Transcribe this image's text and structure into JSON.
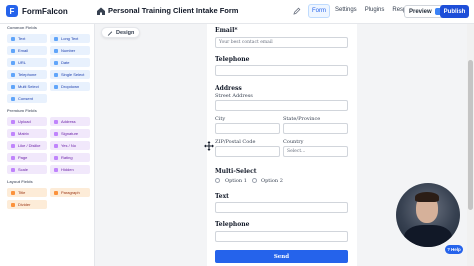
{
  "app": {
    "name": "FormFalcon",
    "logo_letter": "F"
  },
  "header": {
    "form_title": "Personal Training Client Intake Form",
    "tabs": [
      {
        "label": "Form",
        "active": true
      },
      {
        "label": "Settings",
        "active": false
      },
      {
        "label": "Plugins",
        "active": false
      },
      {
        "label": "Responses",
        "active": false
      }
    ],
    "preview_label": "Preview",
    "publish_label": "Publish"
  },
  "sidebar": {
    "common_title": "Common Fields",
    "common": [
      "Text",
      "Long Text",
      "Email",
      "Number",
      "URL",
      "Date",
      "Telephone",
      "Single Select",
      "Multi Select",
      "Dropdown",
      "Consent"
    ],
    "premium_title": "Premium Fields",
    "premium": [
      "Upload",
      "Address",
      "Matrix",
      "Signature",
      "Like / Dislike",
      "Yes / No",
      "Page",
      "Rating",
      "Scale",
      "Hidden"
    ],
    "layout_title": "Layout Fields",
    "layout": [
      "Title",
      "Paragraph",
      "Divider"
    ]
  },
  "canvas": {
    "design_label": "Design",
    "form": {
      "email_label": "Email*",
      "email_placeholder": "Your best contact email",
      "telephone_label": "Telephone",
      "address_label": "Address",
      "street_label": "Street Address",
      "city_label": "City",
      "state_label": "State/Province",
      "zip_label": "ZIP/Postal Code",
      "country_label": "Country",
      "country_placeholder": "Select...",
      "multiselect_label": "Multi-Select",
      "option1": "Option 1",
      "option2": "Option 2",
      "text_label": "Text",
      "telephone2_label": "Telephone",
      "send_label": "Send"
    }
  },
  "help_label": "Help",
  "colors": {
    "accent": "#2563eb",
    "common_bg": "#e8f1fd",
    "premium_bg": "#f1e8fb",
    "layout_bg": "#fdecd8"
  }
}
